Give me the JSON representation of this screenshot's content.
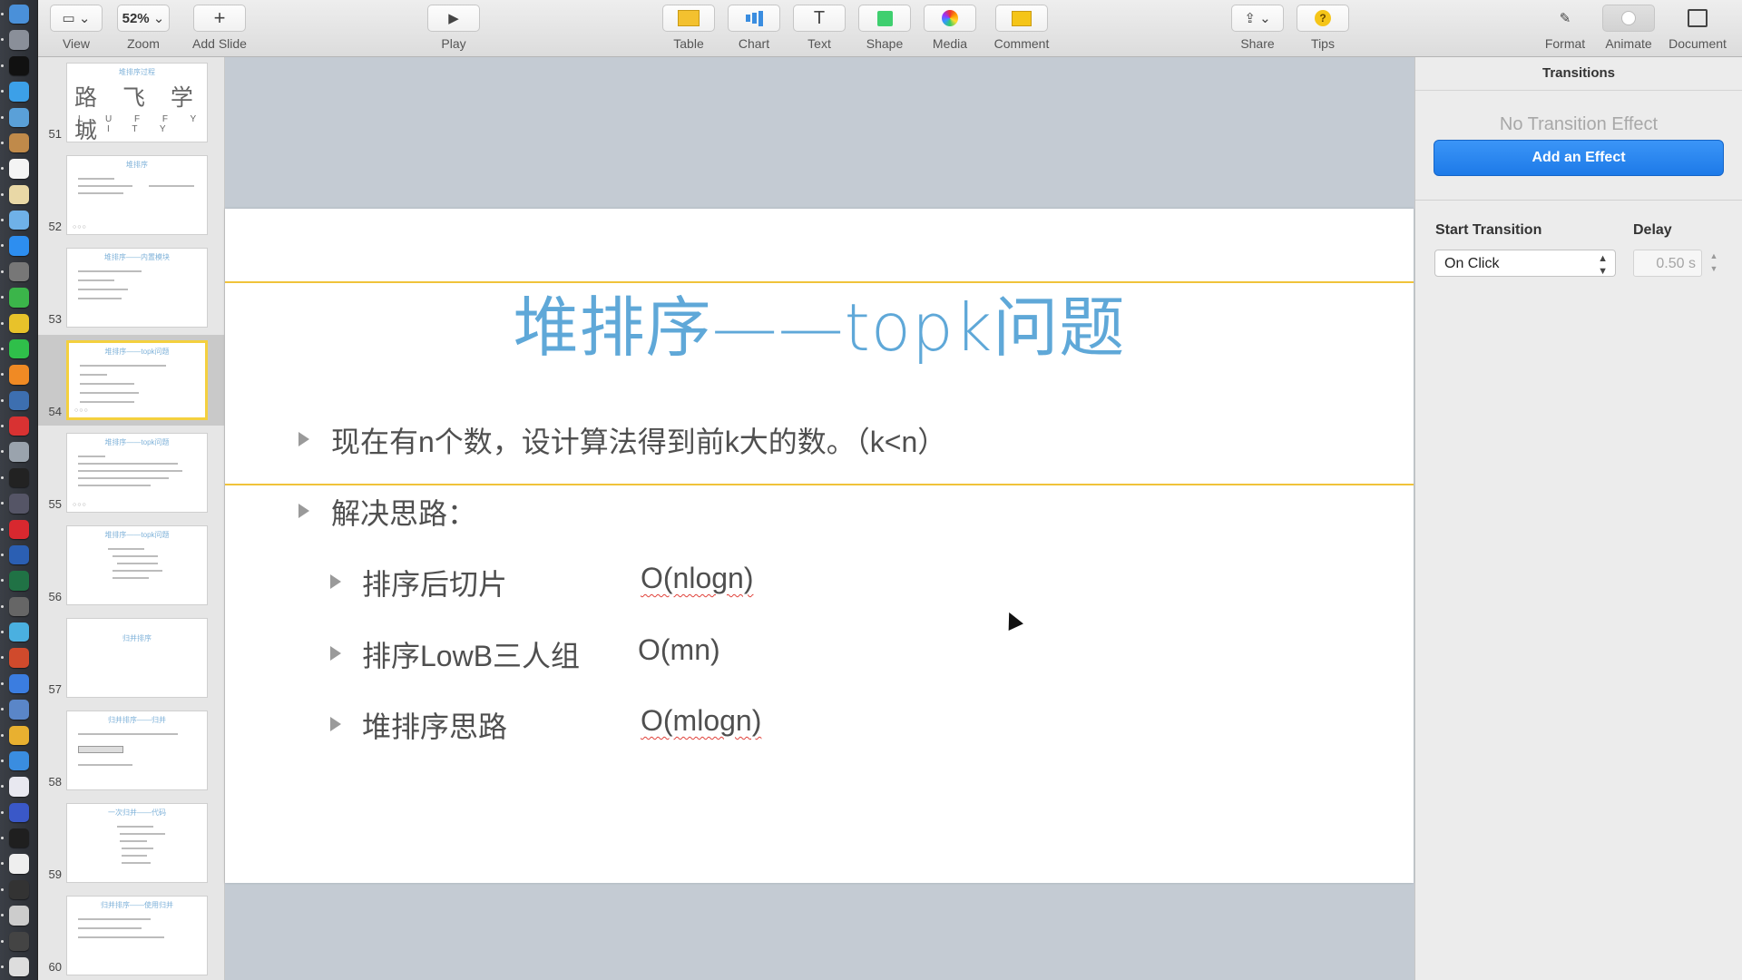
{
  "toolbar": {
    "view": {
      "label": "View",
      "icon": "sidebar-layout-icon"
    },
    "zoom": {
      "label": "Zoom",
      "value": "52%"
    },
    "add_slide": {
      "label": "Add Slide",
      "icon": "plus-icon"
    },
    "play": {
      "label": "Play",
      "icon": "play-icon"
    },
    "table": {
      "label": "Table",
      "icon": "table-icon"
    },
    "chart": {
      "label": "Chart",
      "icon": "chart-icon"
    },
    "text": {
      "label": "Text",
      "icon": "text-icon"
    },
    "shape": {
      "label": "Shape",
      "icon": "shape-icon"
    },
    "media": {
      "label": "Media",
      "icon": "media-icon"
    },
    "comment": {
      "label": "Comment",
      "icon": "comment-icon"
    },
    "share": {
      "label": "Share",
      "icon": "share-icon"
    },
    "tips": {
      "label": "Tips",
      "icon": "tips-icon"
    },
    "format": {
      "label": "Format",
      "icon": "paintbrush-icon"
    },
    "animate": {
      "label": "Animate",
      "icon": "animate-icon"
    },
    "document": {
      "label": "Document",
      "icon": "document-icon"
    }
  },
  "navigator": {
    "slides": [
      {
        "number": "51",
        "title": "堆排序过程",
        "watermark": "路 飞 学 城",
        "watermark_sub": "L U F F Y C I T Y"
      },
      {
        "number": "52",
        "title": "堆排序"
      },
      {
        "number": "53",
        "title": "堆排序——内置模块"
      },
      {
        "number": "54",
        "title": "堆排序——topk问题",
        "selected": true
      },
      {
        "number": "55",
        "title": "堆排序——topk问题"
      },
      {
        "number": "56",
        "title": "堆排序——topk问题"
      },
      {
        "number": "57",
        "title": "归并排序"
      },
      {
        "number": "58",
        "title": "归并排序——归并"
      },
      {
        "number": "59",
        "title": "一次归并——代码"
      },
      {
        "number": "60",
        "title": "归并排序——使用归并"
      }
    ]
  },
  "slide": {
    "title": "堆排序——topk问题",
    "bullets": [
      {
        "text": "现在有n个数，设计算法得到前k大的数。（k<n）"
      },
      {
        "text": "解决思路："
      }
    ],
    "sub_bullets": [
      {
        "text": "排序后切片",
        "complexity": "O(nlogn)"
      },
      {
        "text": "排序LowB三人组",
        "complexity": "O(mn)"
      },
      {
        "text": "堆排序思路",
        "complexity": "O(mlogn)"
      }
    ]
  },
  "inspector": {
    "tab": "Transitions",
    "no_effect": "No Transition Effect",
    "add_effect": "Add an Effect",
    "start_label": "Start Transition",
    "start_value": "On Click",
    "delay_label": "Delay",
    "delay_value": "0.50 s"
  },
  "colors": {
    "title_blue": "#5fa8d8",
    "guide_yellow": "#f0c33a",
    "button_blue": "#1d7ae8"
  }
}
